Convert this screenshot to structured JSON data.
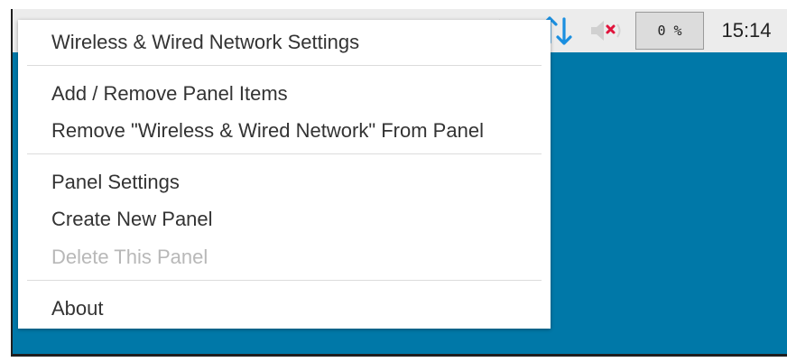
{
  "theme": {
    "desktop_color": "#0078a8",
    "network_icon_color": "#1a8fe0",
    "mute_x_color": "#e0143c",
    "disabled_text_color": "#b8b8b8"
  },
  "taskbar": {
    "cpu_usage": "0 %",
    "clock": "15:14",
    "icons": [
      "pointer-faint-icon",
      "network-arrows-icon",
      "volume-muted-icon"
    ]
  },
  "context_menu": {
    "groups": [
      [
        {
          "label": "Wireless & Wired Network Settings",
          "enabled": true
        }
      ],
      [
        {
          "label": "Add / Remove Panel Items",
          "enabled": true
        },
        {
          "label": "Remove \"Wireless & Wired Network\" From Panel",
          "enabled": true
        }
      ],
      [
        {
          "label": "Panel Settings",
          "enabled": true
        },
        {
          "label": "Create New Panel",
          "enabled": true
        },
        {
          "label": "Delete This Panel",
          "enabled": false
        }
      ],
      [
        {
          "label": "About",
          "enabled": true
        }
      ]
    ]
  }
}
